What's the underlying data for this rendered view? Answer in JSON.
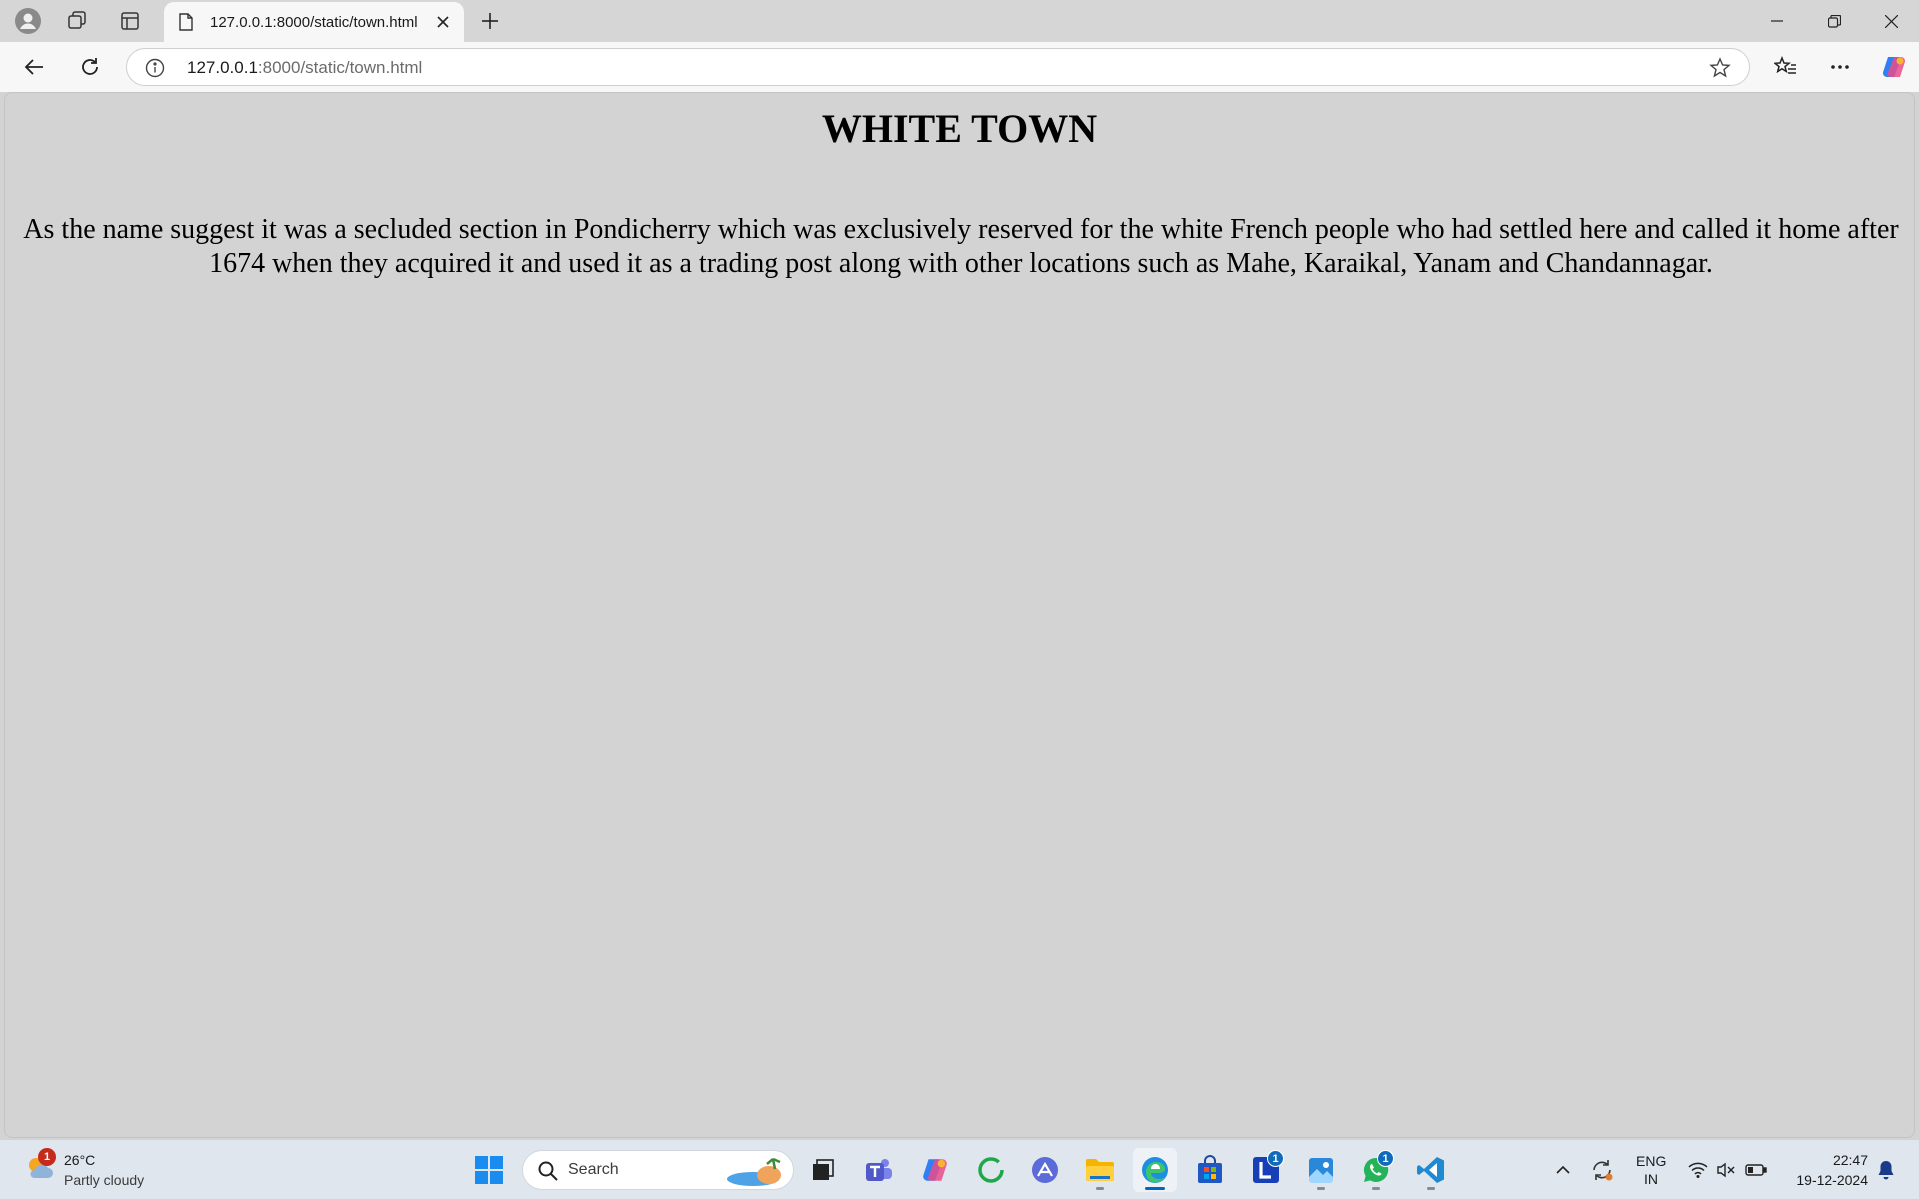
{
  "browser": {
    "tab": {
      "title": "127.0.0.1:8000/static/town.html"
    },
    "address": {
      "host": "127.0.0.1",
      "path": ":8000/static/town.html"
    }
  },
  "page": {
    "heading": "WHITE TOWN",
    "paragraph": "As the name suggest it was a secluded section in Pondicherry which was exclusively reserved for the white French people who had settled here and called it home after 1674 when they acquired it and used it as a trading post along with other locations such as Mahe, Karaikal, Yanam and Chandannagar.",
    "background_color": "#d3d3d3"
  },
  "taskbar": {
    "weather": {
      "temp": "26°C",
      "desc": "Partly cloudy",
      "badge": "1"
    },
    "search_label": "Search",
    "badges": {
      "teams_l": "1",
      "whatsapp": "1"
    },
    "tray": {
      "lang_line1": "ENG",
      "lang_line2": "IN"
    },
    "clock": {
      "time": "22:47",
      "date": "19-12-2024"
    }
  }
}
